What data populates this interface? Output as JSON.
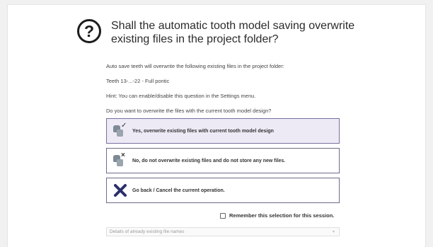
{
  "dialog": {
    "title": "Shall the automatic tooth model saving overwrite existing files in the project folder?",
    "info_line": "Auto save teeth will overwrite the following existing files in the project folder:",
    "teeth_line": "Teeth 13-...-22 - Full pontic",
    "hint_line": "Hint: You can enable/disable this question in the Settings menu.",
    "question_line": "Do you want to overwrite the files with the current tooth model design?"
  },
  "options": [
    {
      "label": "Yes, overwrite existing files with current tooth model design",
      "icon": "tooth-check-icon",
      "selected": true
    },
    {
      "label": "No, do not overwrite existing files and do not store any new files.",
      "icon": "tooth-x-icon",
      "selected": false
    },
    {
      "label": "Go back / Cancel the current operation.",
      "icon": "cancel-x-icon",
      "selected": false
    }
  ],
  "remember": {
    "label": "Remember this selection for this session.",
    "checked": false
  },
  "details": {
    "label": "Details of already existing file names"
  },
  "colors": {
    "selected_bg": "#edeaf6",
    "option_border": "#6f6a8a",
    "cancel_x": "#2b2f6b"
  }
}
